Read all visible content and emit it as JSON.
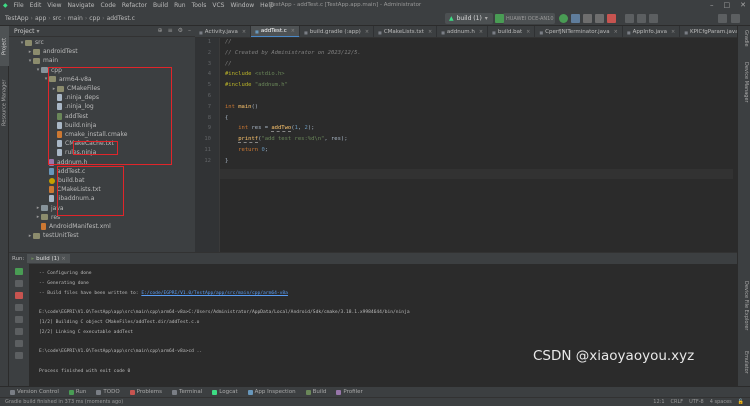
{
  "menu": {
    "items": [
      "File",
      "Edit",
      "View",
      "Navigate",
      "Code",
      "Refactor",
      "Build",
      "Run",
      "Tools",
      "VCS",
      "Window",
      "Help"
    ]
  },
  "window": {
    "title": "TestApp - addTest.c [TestApp.app.main] - Administrator"
  },
  "breadcrumb": [
    "TestApp",
    "app",
    "src",
    "main",
    "cpp",
    "addTest.c"
  ],
  "toolbar": {
    "run_config": "build (1)",
    "device": "HUAWEI OCE-AN10"
  },
  "left_stripe": {
    "project": "Project",
    "resource_manager": "Resource Manager"
  },
  "right_stripe": {
    "gradle": "Gradle",
    "device_manager": "Device Manager",
    "device_file_explorer": "Device File Explorer",
    "emulator": "Emulator"
  },
  "project_panel": {
    "title": "Project",
    "tree": [
      {
        "label": "src",
        "indent": 1,
        "arrow": "▾",
        "icon": "folder"
      },
      {
        "label": "androidTest",
        "indent": 2,
        "arrow": "▸",
        "icon": "folder"
      },
      {
        "label": "main",
        "indent": 2,
        "arrow": "▾",
        "icon": "folder"
      },
      {
        "label": "cpp",
        "indent": 3,
        "arrow": "▾",
        "icon": "folder-blue"
      },
      {
        "label": "arm64-v8a",
        "indent": 4,
        "arrow": "▾",
        "icon": "folder"
      },
      {
        "label": "CMakeFiles",
        "indent": 5,
        "arrow": "▸",
        "icon": "folder"
      },
      {
        "label": ".ninja_deps",
        "indent": 5,
        "arrow": "",
        "icon": "file"
      },
      {
        "label": ".ninja_log",
        "indent": 5,
        "arrow": "",
        "icon": "file"
      },
      {
        "label": "addTest",
        "indent": 5,
        "arrow": "",
        "icon": "file-exe"
      },
      {
        "label": "build.ninja",
        "indent": 5,
        "arrow": "",
        "icon": "file"
      },
      {
        "label": "cmake_install.cmake",
        "indent": 5,
        "arrow": "",
        "icon": "file-cmake"
      },
      {
        "label": "CMakeCache.txt",
        "indent": 5,
        "arrow": "",
        "icon": "file"
      },
      {
        "label": "rules.ninja",
        "indent": 5,
        "arrow": "",
        "icon": "file"
      },
      {
        "label": "addnum.h",
        "indent": 4,
        "arrow": "",
        "icon": "file-h"
      },
      {
        "label": "addTest.c",
        "indent": 4,
        "arrow": "",
        "icon": "file-c"
      },
      {
        "label": "build.bat",
        "indent": 4,
        "arrow": "",
        "icon": "file-gradle"
      },
      {
        "label": "CMakeLists.txt",
        "indent": 4,
        "arrow": "",
        "icon": "file-cmake"
      },
      {
        "label": "libaddnum.a",
        "indent": 4,
        "arrow": "",
        "icon": "file"
      },
      {
        "label": "java",
        "indent": 3,
        "arrow": "▸",
        "icon": "folder-blue"
      },
      {
        "label": "res",
        "indent": 3,
        "arrow": "▸",
        "icon": "folder"
      },
      {
        "label": "AndroidManifest.xml",
        "indent": 3,
        "arrow": "",
        "icon": "file-cmake"
      },
      {
        "label": "testUnitTest",
        "indent": 2,
        "arrow": "▸",
        "icon": "folder"
      }
    ]
  },
  "editor_tabs": [
    {
      "label": "Activity.java",
      "active": false
    },
    {
      "label": "addTest.c",
      "active": true
    },
    {
      "label": "build.gradle (:app)",
      "active": false
    },
    {
      "label": "CMakeLists.txt",
      "active": false
    },
    {
      "label": "addnum.h",
      "active": false
    },
    {
      "label": "build.bat",
      "active": false
    },
    {
      "label": "CperfJNITerminator.java",
      "active": false
    },
    {
      "label": "AppInfo.java",
      "active": false
    },
    {
      "label": "KPICfgParam.java",
      "active": false
    }
  ],
  "editor": {
    "lines": [
      {
        "n": "1",
        "parts": [
          {
            "t": "//",
            "c": "cm"
          }
        ]
      },
      {
        "n": "2",
        "parts": [
          {
            "t": "// Created by Administrator on 2023/12/5.",
            "c": "cm"
          }
        ]
      },
      {
        "n": "3",
        "parts": [
          {
            "t": "//",
            "c": "cm"
          }
        ]
      },
      {
        "n": "4",
        "parts": [
          {
            "t": "#include ",
            "c": "pp"
          },
          {
            "t": "<stdio.h>",
            "c": "str"
          }
        ]
      },
      {
        "n": "5",
        "parts": [
          {
            "t": "#include ",
            "c": "pp"
          },
          {
            "t": "\"addnum.h\"",
            "c": "str"
          }
        ]
      },
      {
        "n": "6",
        "parts": []
      },
      {
        "n": "7",
        "parts": [
          {
            "t": "int ",
            "c": "kw"
          },
          {
            "t": "main",
            "c": "fn"
          },
          {
            "t": "()",
            "c": ""
          }
        ]
      },
      {
        "n": "8",
        "parts": [
          {
            "t": "{",
            "c": ""
          }
        ]
      },
      {
        "n": "9",
        "parts": [
          {
            "t": "    ",
            "c": ""
          },
          {
            "t": "int ",
            "c": "kw"
          },
          {
            "t": "res = ",
            "c": ""
          },
          {
            "t": "addTwo",
            "c": "fn-under"
          },
          {
            "t": "(",
            "c": ""
          },
          {
            "t": "1",
            "c": "num"
          },
          {
            "t": ", ",
            "c": ""
          },
          {
            "t": "2",
            "c": "num"
          },
          {
            "t": ");",
            "c": ""
          }
        ]
      },
      {
        "n": "10",
        "parts": [
          {
            "t": "    ",
            "c": ""
          },
          {
            "t": "printf",
            "c": "fn-under"
          },
          {
            "t": "(",
            "c": ""
          },
          {
            "t": "\"add test res:%d\\n\"",
            "c": "str"
          },
          {
            "t": ", res);",
            "c": ""
          }
        ]
      },
      {
        "n": "11",
        "parts": [
          {
            "t": "    ",
            "c": ""
          },
          {
            "t": "return ",
            "c": "kw"
          },
          {
            "t": "0",
            "c": "num"
          },
          {
            "t": ";",
            "c": ""
          }
        ]
      },
      {
        "n": "12",
        "parts": [
          {
            "t": "}",
            "c": ""
          }
        ]
      }
    ]
  },
  "run_panel": {
    "run_label": "Run:",
    "tab_label": "build (1)",
    "console": [
      {
        "text": "-- Configuring done"
      },
      {
        "text": "-- Generating done"
      },
      {
        "text": "-- Build files have been written to: ",
        "link": "E:/code/EGPRI/V1.0/TestApp/app/src/main/cpp/arm64-v8a"
      },
      {
        "text": ""
      },
      {
        "text": "E:\\code\\EGPRI\\V1.0\\TestApp\\app\\src\\main\\cpp\\arm64-v8a>C:/Users/Administrator/AppData/Local/Android/Sdk/cmake/3.18.1.x9984644/bin/ninja"
      },
      {
        "text": "[1/2] Building C object CMakeFiles/addTest.dir/addTest.c.o"
      },
      {
        "text": "[2/2] Linking C executable addTest"
      },
      {
        "text": ""
      },
      {
        "text": "E:\\code\\EGPRI\\V1.0\\TestApp\\app\\src\\main\\cpp\\arm64-v8a>cd .."
      },
      {
        "text": ""
      },
      {
        "text": "Process finished with exit code 0"
      }
    ]
  },
  "bottom_tabs": [
    "Version Control",
    "Run",
    "TODO",
    "Problems",
    "Terminal",
    "Logcat",
    "App Inspection",
    "Build",
    "Profiler"
  ],
  "status": {
    "message": "Gradle build finished in 373 ms (moments ago)",
    "position": "12:1",
    "line_sep": "CRLF",
    "encoding": "UTF-8",
    "indent": "4 spaces"
  },
  "watermark": "CSDN @xiaoyaoyou.xyz",
  "colors": {
    "selection": "#0d293e",
    "highlight_box": "#e0252a",
    "accent": "#4a88c7"
  }
}
